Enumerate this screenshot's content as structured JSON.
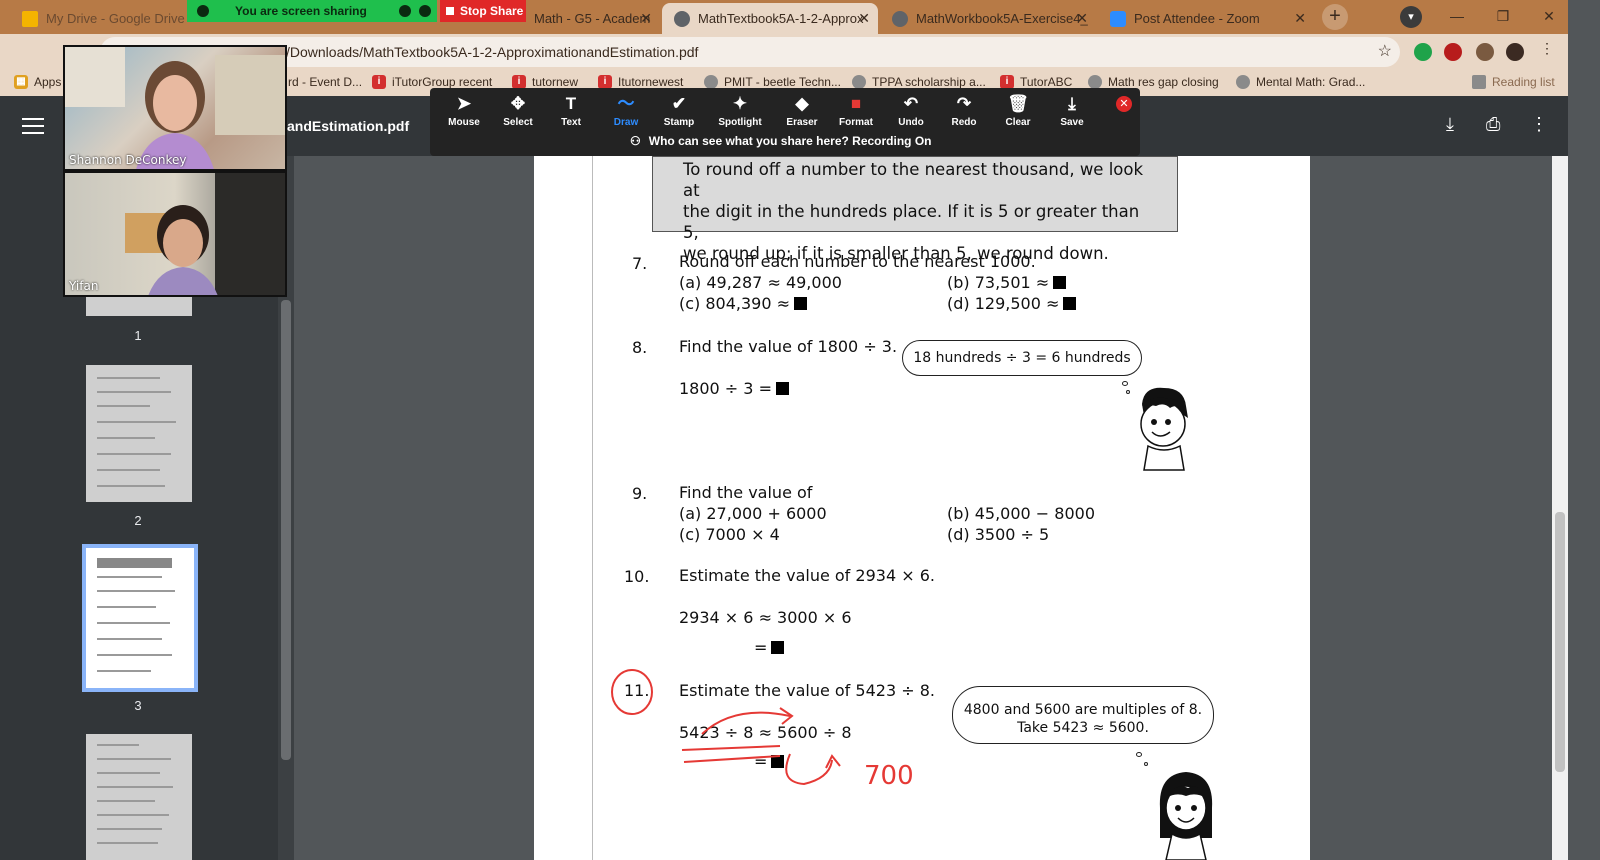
{
  "browser": {
    "tabs": [
      {
        "title": "My Drive - Google Drive",
        "favicon_color": "#f4b400"
      },
      {
        "title": "Math - G5 - Academ",
        "favicon_color": "#2e7d32"
      },
      {
        "title": "MathTextbook5A-1-2-Approx",
        "favicon_color": "#5f6368"
      },
      {
        "title": "MathWorkbook5A-Exercise4_",
        "favicon_color": "#5f6368"
      },
      {
        "title": "Post Attendee - Zoom",
        "favicon_color": "#2d8cff"
      }
    ],
    "url": "/Downloads/MathTextbook5A-1-2-ApproximationandEstimation.pdf",
    "bookmarks": [
      {
        "label": "Apps"
      },
      {
        "label": "rd - Event D..."
      },
      {
        "label": "iTutorGroup recent"
      },
      {
        "label": "tutornew"
      },
      {
        "label": "Itutornewest"
      },
      {
        "label": "PMIT - beetle Techn..."
      },
      {
        "label": "TPPA scholarship a..."
      },
      {
        "label": "TutorABC"
      },
      {
        "label": "Math res gap closing"
      },
      {
        "label": "Mental Math: Grad..."
      },
      {
        "label": "Reading list"
      }
    ]
  },
  "zoom": {
    "sharing_text": "You are screen sharing",
    "stop_share": "Stop Share",
    "tools": [
      {
        "label": "Mouse",
        "glyph": "➤"
      },
      {
        "label": "Select",
        "glyph": "✥"
      },
      {
        "label": "Text",
        "glyph": "T"
      },
      {
        "label": "Draw",
        "glyph": "〜"
      },
      {
        "label": "Stamp",
        "glyph": "✔"
      },
      {
        "label": "Spotlight",
        "glyph": "✦"
      },
      {
        "label": "Eraser",
        "glyph": "◆"
      },
      {
        "label": "Format",
        "glyph": "■"
      },
      {
        "label": "Undo",
        "glyph": "↶"
      },
      {
        "label": "Redo",
        "glyph": "↷"
      },
      {
        "label": "Clear",
        "glyph": "🗑"
      },
      {
        "label": "Save",
        "glyph": "⤓"
      }
    ],
    "recording_note": "Who can see what you share here? Recording On",
    "participants": [
      {
        "name": "Shannon DeConkey"
      },
      {
        "name": "Yifan"
      }
    ]
  },
  "pdf": {
    "filename": "andEstimation.pdf",
    "thumbnail_pages": [
      "1",
      "2",
      "3"
    ],
    "box_text": [
      "To round off a number to the nearest thousand, we look at",
      "the digit in the hundreds place. If it is 5 or greater than 5,",
      "we round up; if it is smaller than 5, we round down."
    ],
    "q7": {
      "num": "7.",
      "text": "Round off each number to the nearest 1000.",
      "a": "(a)   49,287 ≈ 49,000",
      "b": "(b)   73,501 ≈",
      "c": "(c)   804,390 ≈",
      "d": "(d)   129,500 ≈"
    },
    "q8": {
      "num": "8.",
      "text": "Find the value of 1800 ÷ 3.",
      "work": "1800 ÷ 3 =",
      "bubble": "18 hundreds ÷ 3 = 6 hundreds"
    },
    "q9": {
      "num": "9.",
      "text": "Find the value of",
      "a": "(a)   27,000 + 6000",
      "b": "(b)   45,000 − 8000",
      "c": "(c)   7000 × 4",
      "d": "(d)   3500 ÷ 5"
    },
    "q10": {
      "num": "10.",
      "text": "Estimate the value of 2934 × 6.",
      "work": "2934 × 6 ≈ 3000 × 6",
      "eq": "="
    },
    "q11": {
      "num": "11.",
      "text": "Estimate the value of 5423 ÷ 8.",
      "work": "5423 ÷ 8 ≈ 5600 ÷ 8",
      "eq": "=",
      "bubble_1": "4800 and 5600 are multiples of 8.",
      "bubble_2": "Take 5423 ≈ 5600.",
      "handwritten": "700"
    }
  }
}
